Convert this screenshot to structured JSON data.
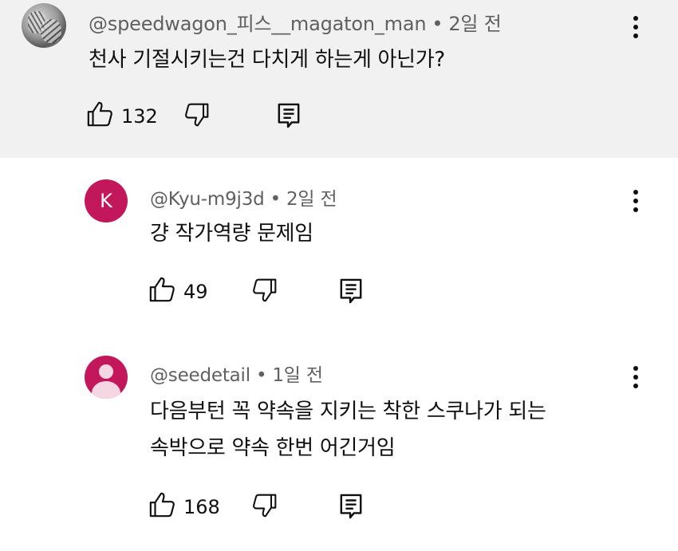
{
  "comments": [
    {
      "author": "@speedwagon_피스__magaton_man",
      "time": "2일 전",
      "lines": [
        "천사 기절시키는건 다치게 하는게 아닌가?"
      ],
      "likes": "132",
      "avatar_icon": "profile-photo"
    },
    {
      "author": "@Kyu-m9j3d",
      "time": "2일 전",
      "lines": [
        "걍 작가역량 문제임"
      ],
      "likes": "49",
      "avatar_letter": "K",
      "avatar_color": "#c2185b"
    },
    {
      "author": "@seedetail",
      "time": "1일 전",
      "lines": [
        "다음부턴 꼭 약속을 지키는 착한 스쿠나가 되는",
        "속박으로 약속 한번 어긴거임"
      ],
      "likes": "168",
      "avatar_icon": "default-person-avatar",
      "avatar_color": "#c2185b"
    }
  ],
  "ui": {
    "separator": "•",
    "highlight_background": "#f1f1f1"
  }
}
